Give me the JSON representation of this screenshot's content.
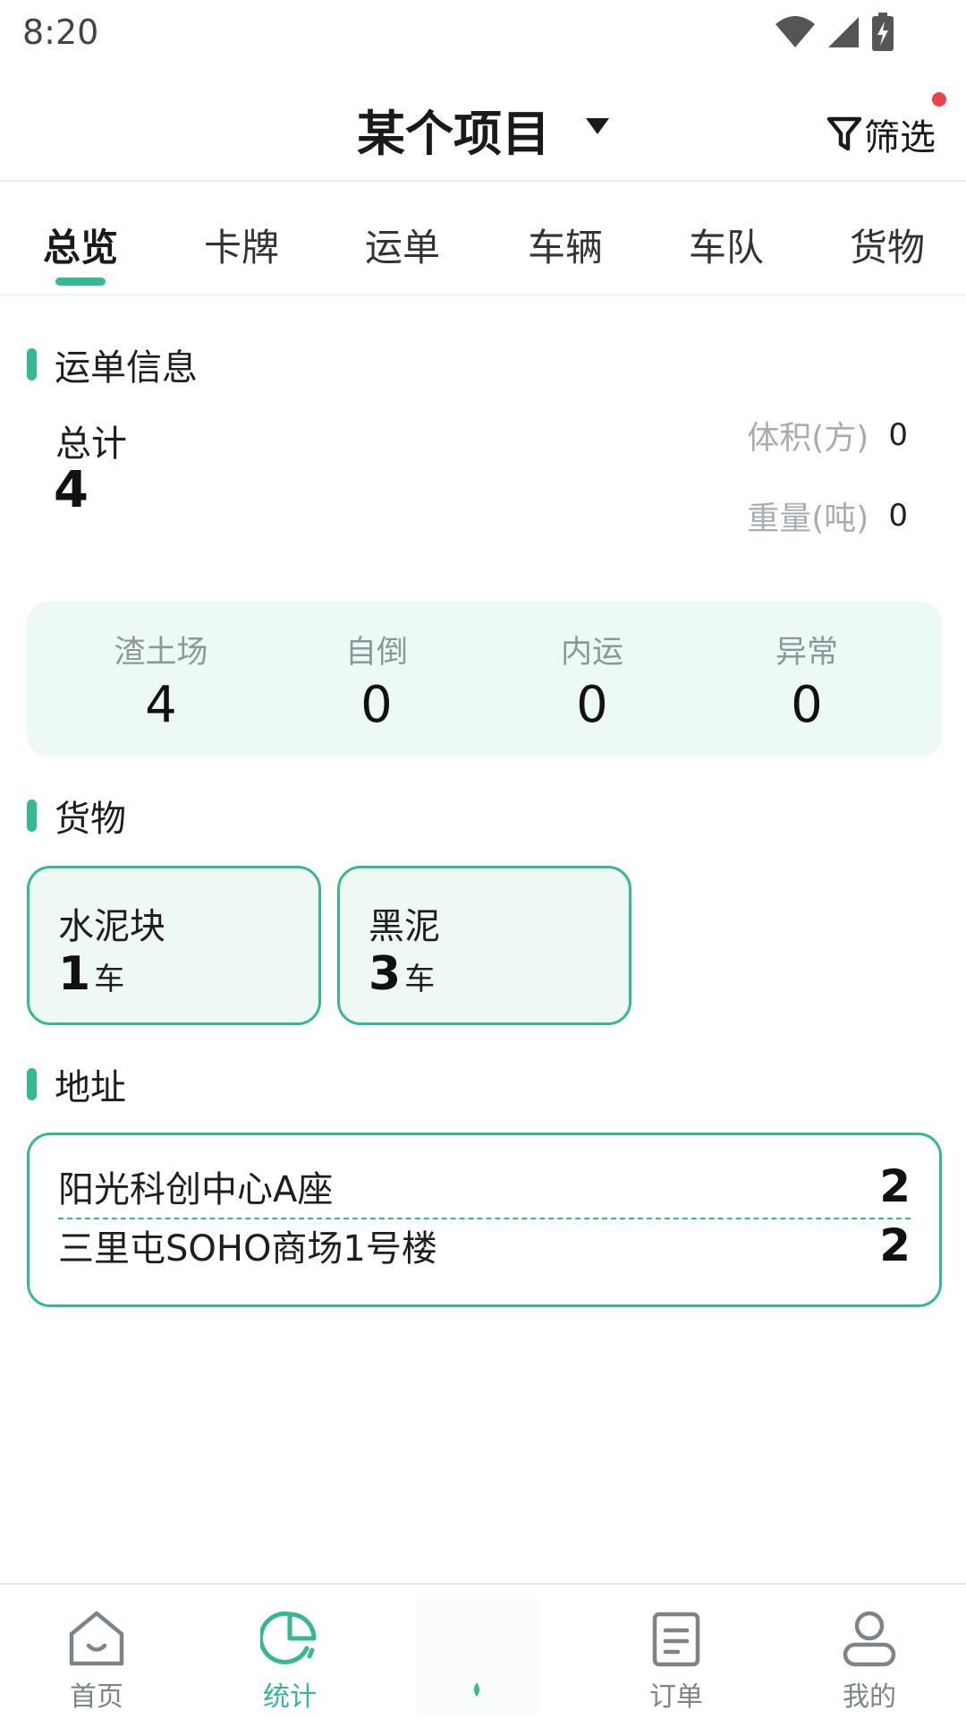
{
  "status_bar": {
    "time": "8:20"
  },
  "header": {
    "project_name": "某个项目",
    "filter_label": "筛选"
  },
  "tabs": [
    {
      "label": "总览",
      "active": true
    },
    {
      "label": "卡牌",
      "active": false
    },
    {
      "label": "运单",
      "active": false
    },
    {
      "label": "车辆",
      "active": false
    },
    {
      "label": "车队",
      "active": false
    },
    {
      "label": "货物",
      "active": false
    }
  ],
  "waybill_info": {
    "section_title": "运单信息",
    "total_label": "总计",
    "total_value": "4",
    "volume_label": "体积(方)",
    "volume_value": "0",
    "weight_label": "重量(吨)",
    "weight_value": "0"
  },
  "types": [
    {
      "label": "渣土场",
      "value": "4"
    },
    {
      "label": "自倒",
      "value": "0"
    },
    {
      "label": "内运",
      "value": "0"
    },
    {
      "label": "异常",
      "value": "0"
    }
  ],
  "goods": {
    "section_title": "货物",
    "items": [
      {
        "name": "水泥块",
        "count": "1",
        "unit": "车"
      },
      {
        "name": "黑泥",
        "count": "3",
        "unit": "车"
      }
    ]
  },
  "address": {
    "section_title": "地址",
    "items": [
      {
        "name": "阳光科创中心A座",
        "count": "2"
      },
      {
        "name": "三里屯SOHO商场1号楼",
        "count": "2"
      }
    ]
  },
  "bottom_nav": [
    {
      "label": "首页",
      "icon": "home-icon",
      "active": false
    },
    {
      "label": "统计",
      "icon": "statistics-icon",
      "active": true
    },
    {
      "label": "订单",
      "icon": "order-icon",
      "active": false
    },
    {
      "label": "我的",
      "icon": "profile-icon",
      "active": false
    }
  ],
  "colors": {
    "accent": "#35b894",
    "type_card_bg": "#ecfaf3",
    "goods_card_bg": "#eef9f4",
    "badge": "#f0414e"
  }
}
